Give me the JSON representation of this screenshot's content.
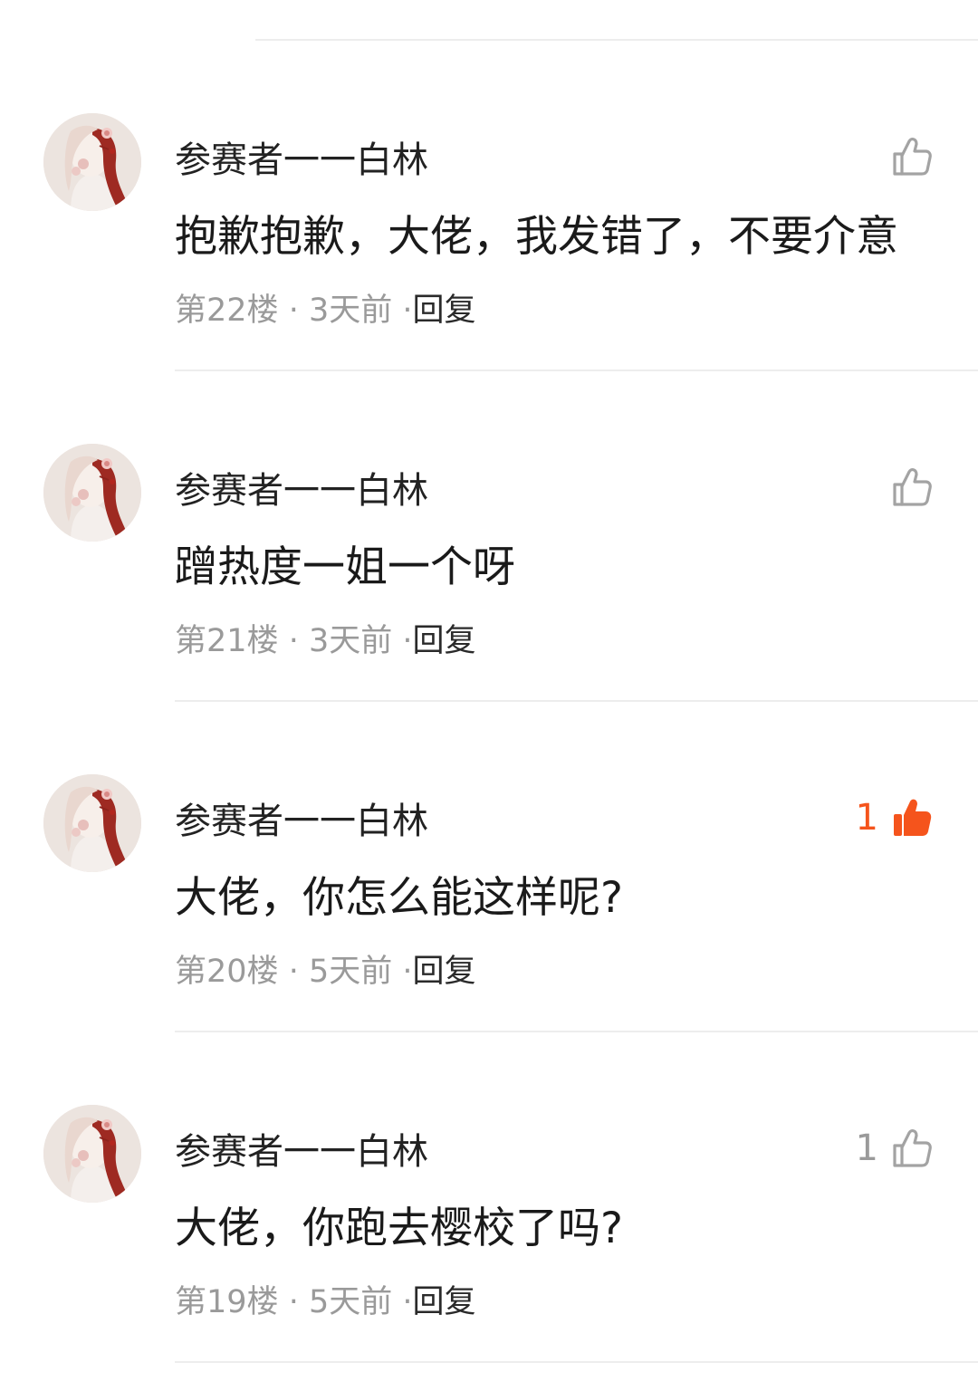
{
  "comments": [
    {
      "username": "参赛者一一白林",
      "content": "抱歉抱歉，大佬，我发错了，不要介意",
      "floor": "第22楼",
      "time": "3天前",
      "reply_label": "回复",
      "like_count": "",
      "liked": false
    },
    {
      "username": "参赛者一一白林",
      "content": "蹭热度一姐一个呀",
      "floor": "第21楼",
      "time": "3天前",
      "reply_label": "回复",
      "like_count": "",
      "liked": false
    },
    {
      "username": "参赛者一一白林",
      "content": "大佬，你怎么能这样呢?",
      "floor": "第20楼",
      "time": "5天前",
      "reply_label": "回复",
      "like_count": "1",
      "liked": true
    },
    {
      "username": "参赛者一一白林",
      "content": "大佬，你跑去樱校了吗?",
      "floor": "第19楼",
      "time": "5天前",
      "reply_label": "回复",
      "like_count": "1",
      "liked": false
    }
  ],
  "separator": "·",
  "icons": {
    "like": "thumbs-up-icon",
    "avatar": "anime-girl-avatar"
  },
  "colors": {
    "liked_accent": "#f5541c",
    "meta_gray": "#9a9a9a",
    "divider": "#ededed"
  }
}
